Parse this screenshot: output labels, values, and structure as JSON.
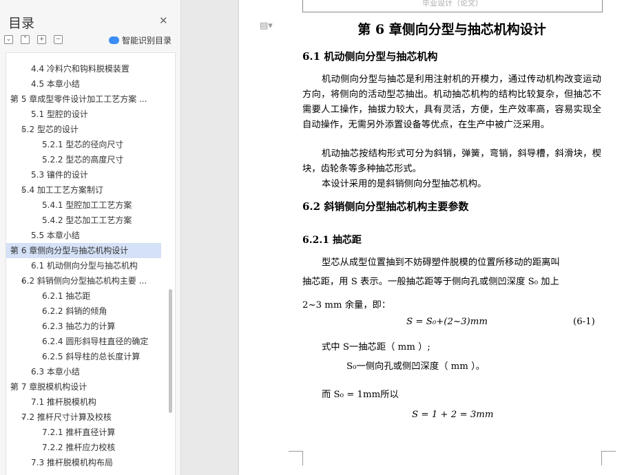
{
  "sidebar": {
    "title": "目录",
    "smart_label": "智能识别目录",
    "toc": [
      {
        "label": "4.4 冷料穴和钩料脱模装置",
        "chev": ""
      },
      {
        "label": "4.5 本章小结",
        "chev": ""
      },
      {
        "label": "第 5 章成型零件设计加工工艺方案 ...",
        "chev": "⌄"
      },
      {
        "label": "5.1 型腔的设计",
        "chev": ""
      },
      {
        "label": "5.2 型芯的设计",
        "chev": "⌄"
      },
      {
        "label": "5.2.1 型芯的径向尺寸",
        "chev": ""
      },
      {
        "label": "5.2.2 型芯的高度尺寸",
        "chev": ""
      },
      {
        "label": "5.3 镶件的设计",
        "chev": ""
      },
      {
        "label": "5.4 加工工艺方案制订",
        "chev": "⌄"
      },
      {
        "label": "5.4.1 型腔加工工艺方案",
        "chev": ""
      },
      {
        "label": "5.4.2 型芯加工工艺方案",
        "chev": ""
      },
      {
        "label": "5.5 本章小结",
        "chev": ""
      },
      {
        "label": "第 6 章侧向分型与抽芯机构设计",
        "chev": "⌄"
      },
      {
        "label": "6.1 机动侧向分型与抽芯机构",
        "chev": ""
      },
      {
        "label": "6.2 斜销侧向分型抽芯机构主要 ...",
        "chev": "⌄"
      },
      {
        "label": "6.2.1 抽芯距",
        "chev": ""
      },
      {
        "label": "6.2.2 斜销的倾角",
        "chev": ""
      },
      {
        "label": "6.2.3 抽芯力的计算",
        "chev": ""
      },
      {
        "label": "6.2.4 圆形斜导柱直径的确定",
        "chev": ""
      },
      {
        "label": "6.2.5 斜导柱的总长度计算",
        "chev": ""
      },
      {
        "label": "6.3 本章小结",
        "chev": ""
      },
      {
        "label": "第 7 章脱模机构设计",
        "chev": "⌄"
      },
      {
        "label": "7.1 推杆脱模机构",
        "chev": ""
      },
      {
        "label": "7.2 推杆尺寸计算及校核",
        "chev": "⌄"
      },
      {
        "label": "7.2.1 推杆直径计算",
        "chev": ""
      },
      {
        "label": "7.2.2 推杆应力校核",
        "chev": ""
      },
      {
        "label": "7.3 推杆脱模机构布局",
        "chev": ""
      }
    ]
  },
  "document": {
    "header": "毕业设计（论文）",
    "chapter_title": "第 6 章侧向分型与抽芯机构设计",
    "s61_title": "6.1 机动侧向分型与抽芯机构",
    "p1": "机动侧向分型与抽芯是利用注射机的开模力，通过传动机构改变运动方向，将侧向的活动型芯抽出。机动抽芯机构的结构比较复杂，但抽芯不需要人工操作，抽拔力较大，具有灵活，方便，生产效率高，容易实现全自动操作，无需另外添置设备等优点，在生产中被广泛采用。",
    "p2": "机动抽芯按结构形式可分为斜销，弹簧，弯销，斜导槽，斜滑块，楔块，齿轮条等多种抽芯形式。",
    "p3": "本设计采用的是斜销侧向分型抽芯机构。",
    "s62_title": "6.2 斜销侧向分型抽芯机构主要参数",
    "s621_title": "6.2.1 抽芯距",
    "p4_l1": "型芯从成型位置抽到不妨碍塑件脱模的位置所移动的距离叫",
    "p4_l2": "抽芯距，用 S 表示。一般抽芯距等于侧向孔或侧凹深度 S₀ 加上",
    "p4_l3": "2~3 mm 余量，即：",
    "formula1": "S = S₀+(2~3)mm",
    "formula1_num": "(6-1)",
    "where_l1": "式中 S一抽芯距（ mm ）;",
    "where_l2": "S₀一侧向孔或侧凹深度（ mm ）。",
    "and_line": "而 S₀ = 1mm所以",
    "formula2": "S = 1 + 2 = 3mm"
  }
}
